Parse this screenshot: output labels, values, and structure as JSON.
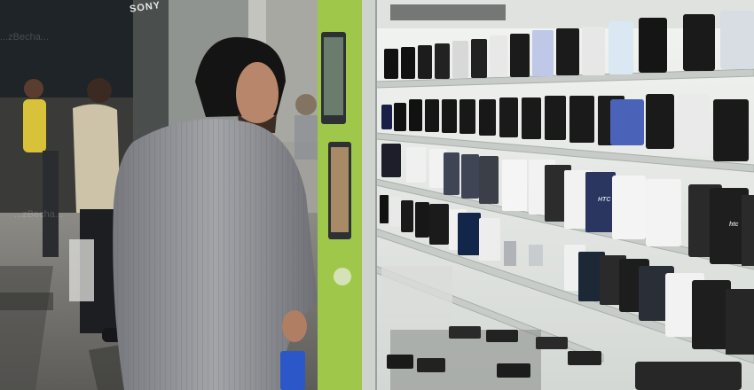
{
  "scene": {
    "store_sign": "SONY",
    "phone_brand_labels": [
      "HTC",
      "htc"
    ],
    "watermarks": [
      "...zBecha...",
      "...ehchin.co...",
      "...zBecha..."
    ]
  },
  "colors": {
    "shelf_green": "#9fc84a",
    "wall_white": "#e9ece8",
    "floor": "#6f6e6a",
    "shirt": "#8d8f93"
  }
}
